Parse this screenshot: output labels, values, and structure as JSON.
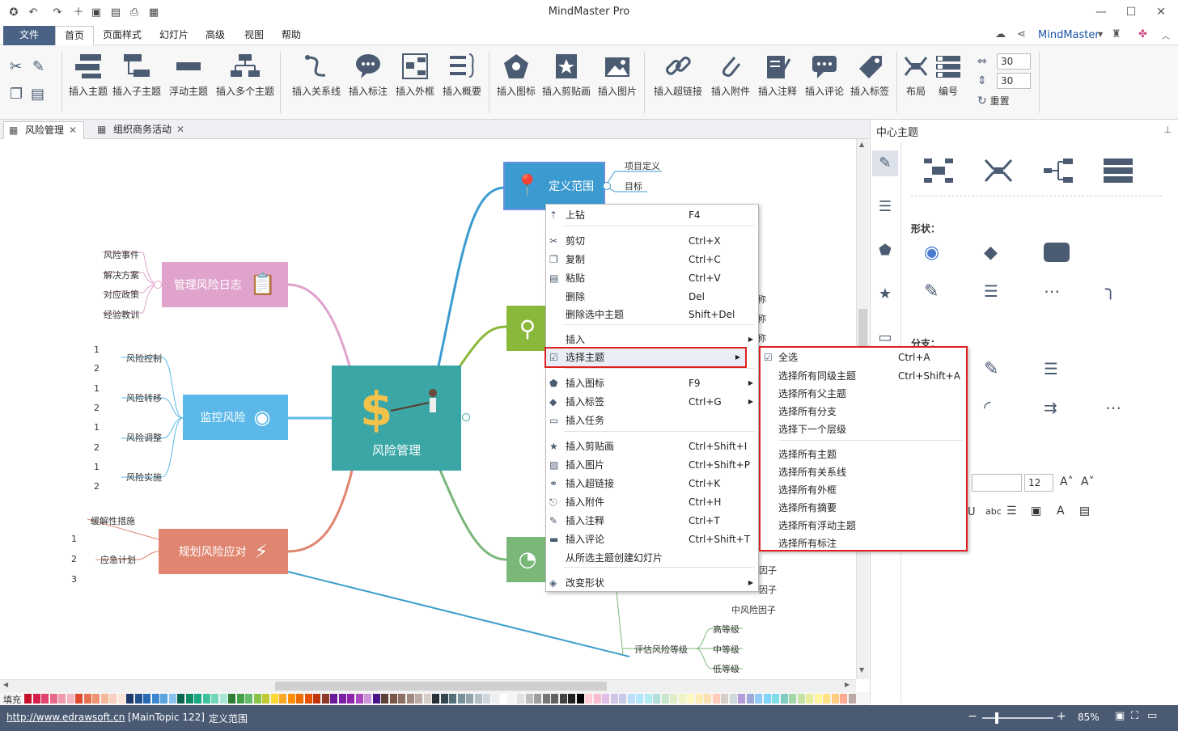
{
  "app": {
    "title": "MindMaster Pro"
  },
  "menus": {
    "file": "文件",
    "home": "首页",
    "page_style": "页面样式",
    "slides": "幻灯片",
    "advanced": "高级",
    "view": "视图",
    "help": "帮助"
  },
  "account": {
    "brand": "MindMaster"
  },
  "ribbon": {
    "insert_topic": "插入主题",
    "insert_subtopic": "插入子主题",
    "floating_topic": "浮动主题",
    "insert_multiple": "插入多个主题",
    "insert_relation": "插入关系线",
    "insert_callout": "插入标注",
    "insert_boundary": "插入外框",
    "insert_summary": "插入概要",
    "insert_icon": "插入图标",
    "insert_clipart": "插入剪贴画",
    "insert_picture": "插入图片",
    "insert_hyperlink": "插入超链接",
    "insert_attachment": "插入附件",
    "insert_note": "插入注释",
    "insert_comment": "插入评论",
    "insert_tag": "插入标签",
    "layout": "布局",
    "numbering": "编号",
    "spacing_h": "30",
    "spacing_v": "30",
    "reset": "重置"
  },
  "doc_tabs": [
    "风险管理",
    "组织商务活动"
  ],
  "side_panel": {
    "title": "中心主题",
    "shape_label": "形状：",
    "branch_label": "分支：",
    "font_size": "12"
  },
  "mindmap": {
    "center": "风险管理",
    "topics": {
      "scope": "定义范围",
      "log": "管理风险日志",
      "monitor": "监控风险",
      "plan": "规划风险应对"
    },
    "scope_children": [
      "项目定义",
      "目标"
    ],
    "log_children": [
      "风险事件",
      "解决方案",
      "对应政策",
      "经验教训"
    ],
    "monitor_children": [
      "风险控制",
      "风险转移",
      "风险调整",
      "风险实施"
    ],
    "plan_children": [
      "缓解性措施",
      "应急计划"
    ],
    "numbers": [
      "1",
      "2",
      "3"
    ],
    "right_fragments": [
      "称",
      "称",
      "称",
      "因子",
      "因子",
      "中风险因子"
    ],
    "assess": "评估风险等级",
    "assess_children": [
      "高等级",
      "中等级",
      "低等级"
    ]
  },
  "context_menu": {
    "items": [
      {
        "label": "上钻",
        "shortcut": "F4"
      },
      {
        "label": "剪切",
        "shortcut": "Ctrl+X"
      },
      {
        "label": "复制",
        "shortcut": "Ctrl+C"
      },
      {
        "label": "粘贴",
        "shortcut": "Ctrl+V"
      },
      {
        "label": "删除",
        "shortcut": "Del"
      },
      {
        "label": "删除选中主题",
        "shortcut": "Shift+Del"
      },
      {
        "label": "插入",
        "shortcut": ""
      },
      {
        "label": "选择主题",
        "shortcut": ""
      },
      {
        "label": "插入图标",
        "shortcut": "F9"
      },
      {
        "label": "插入标签",
        "shortcut": "Ctrl+G"
      },
      {
        "label": "插入任务",
        "shortcut": ""
      },
      {
        "label": "插入剪贴画",
        "shortcut": "Ctrl+Shift+I"
      },
      {
        "label": "插入图片",
        "shortcut": "Ctrl+Shift+P"
      },
      {
        "label": "插入超链接",
        "shortcut": "Ctrl+K"
      },
      {
        "label": "插入附件",
        "shortcut": "Ctrl+H"
      },
      {
        "label": "插入注释",
        "shortcut": "Ctrl+T"
      },
      {
        "label": "插入评论",
        "shortcut": "Ctrl+Shift+T"
      },
      {
        "label": "从所选主题创建幻灯片",
        "shortcut": ""
      },
      {
        "label": "改变形状",
        "shortcut": ""
      }
    ]
  },
  "submenu": {
    "items": [
      {
        "label": "全选",
        "shortcut": "Ctrl+A"
      },
      {
        "label": "选择所有同级主题",
        "shortcut": "Ctrl+Shift+A"
      },
      {
        "label": "选择所有父主题",
        "shortcut": ""
      },
      {
        "label": "选择所有分支",
        "shortcut": ""
      },
      {
        "label": "选择下一个层级",
        "shortcut": ""
      },
      {
        "label": "选择所有主题",
        "shortcut": ""
      },
      {
        "label": "选择所有关系线",
        "shortcut": ""
      },
      {
        "label": "选择所有外框",
        "shortcut": ""
      },
      {
        "label": "选择所有摘要",
        "shortcut": ""
      },
      {
        "label": "选择所有浮动主题",
        "shortcut": ""
      },
      {
        "label": "选择所有标注",
        "shortcut": ""
      }
    ]
  },
  "palette": {
    "label": "填充"
  },
  "status": {
    "url": "http://www.edrawsoft.cn",
    "selection": "[MainTopic 122]",
    "topic": "定义范围",
    "zoom": "85%"
  },
  "colors": {
    "file_tab": "#4a6285",
    "center": "#3aa6a6",
    "scope": "#3b9bd0",
    "log": "#e0a3cc",
    "monitor": "#5bb8e8",
    "plan": "#e0856f",
    "status": "#4a5a73",
    "highlight": "#e02020"
  }
}
